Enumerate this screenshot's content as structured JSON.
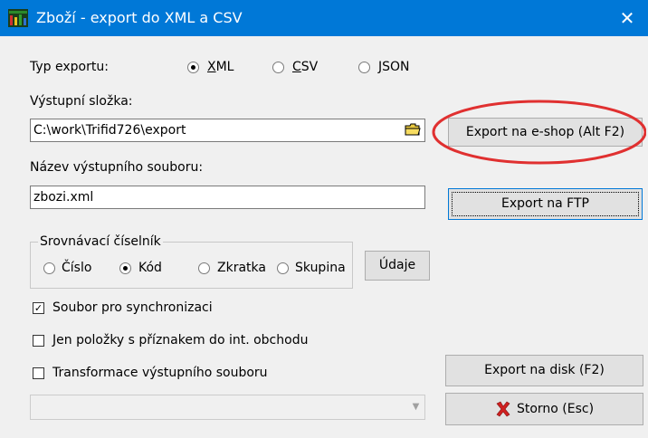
{
  "window": {
    "title": "Zboží - export do XML a CSV",
    "close_glyph": "✕",
    "accent": "#0078d7"
  },
  "typ_exportu": {
    "label": "Typ exportu:",
    "options": [
      {
        "pre": "",
        "key": "X",
        "post": "ML",
        "selected": true
      },
      {
        "pre": "",
        "key": "C",
        "post": "SV",
        "selected": false
      },
      {
        "pre": "",
        "key": "J",
        "post": "SON",
        "selected": false
      }
    ]
  },
  "vystupni_slozka": {
    "label": "Výstupní složka:",
    "value": "C:\\work\\Trifid726\\export",
    "icon": "folder-icon"
  },
  "nazev_souboru": {
    "label": "Název výstupního souboru:",
    "value": "zbozi.xml"
  },
  "buttons": {
    "export_eshop": "Export na e-shop (Alt F2)",
    "export_ftp": "Export na FTP",
    "udaje": "Údaje",
    "export_disk": "Export na disk (F2)",
    "storno": "Storno (Esc)"
  },
  "srovnavaci": {
    "legend": "Srovnávací číselník",
    "options": [
      {
        "label": "Číslo",
        "selected": false
      },
      {
        "label": "Kód",
        "selected": true
      },
      {
        "label": "Zkratka",
        "selected": false
      },
      {
        "label": "Skupina",
        "selected": false
      }
    ]
  },
  "checkboxes": [
    {
      "label": "Soubor pro synchronizaci",
      "checked": true
    },
    {
      "label": "Jen položky s příznakem do int. obchodu",
      "checked": false
    },
    {
      "label": "Transformace výstupního souboru",
      "checked": false
    }
  ],
  "transform_select": {
    "value": "",
    "disabled": true
  },
  "annotation": {
    "color": "#e03030",
    "shape": "red-ellipse"
  }
}
